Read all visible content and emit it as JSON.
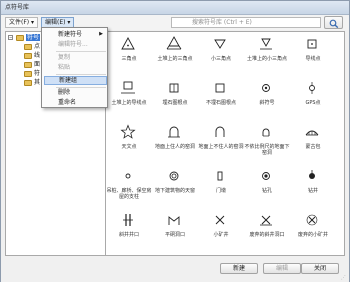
{
  "window": {
    "title": "点符号库"
  },
  "toolbar": {
    "file_menu": "文件(F) ▾",
    "edit_menu": "编辑(E) ▾",
    "search_placeholder": "搜索符号库 (Ctrl + E)"
  },
  "tree": {
    "root_label": "符号",
    "children": [
      "点",
      "线",
      "面",
      "符",
      "其"
    ]
  },
  "edit_menu_items": [
    {
      "label": "新建符号",
      "state": "normal",
      "has_submenu": true
    },
    {
      "label": "编辑符号...",
      "state": "disabled"
    },
    {
      "label": "复制",
      "state": "disabled"
    },
    {
      "label": "粘贴",
      "state": "disabled"
    },
    {
      "label": "新建组",
      "state": "hover"
    },
    {
      "label": "删除",
      "state": "normal"
    },
    {
      "label": "重命名",
      "state": "normal"
    }
  ],
  "symbols": [
    {
      "label": "三角点",
      "icon": "triangle-dot"
    },
    {
      "label": "土堆上的三角点",
      "icon": "mound-triangle-dot"
    },
    {
      "label": "小三角点",
      "icon": "small-triangle"
    },
    {
      "label": "土堆上的小三角点",
      "icon": "mound-small-triangle"
    },
    {
      "label": "导线点",
      "icon": "square-dot"
    },
    {
      "label": "土堆上的导线点",
      "icon": "mound-square"
    },
    {
      "label": "埋石图根点",
      "icon": "buried-stone"
    },
    {
      "label": "不埋石图根点",
      "icon": "unburied-stone"
    },
    {
      "label": "斜符号",
      "icon": "benchmark"
    },
    {
      "label": "GPS点",
      "icon": "gps-dot"
    },
    {
      "label": "天文点",
      "icon": "star"
    },
    {
      "label": "地面上住人的窑洞",
      "icon": "arch"
    },
    {
      "label": "地面上不住人的窑洞",
      "icon": "arch-open"
    },
    {
      "label": "不依比例尺的地面下窑洞",
      "icon": "arch-small"
    },
    {
      "label": "蒙古包",
      "icon": "yurt"
    },
    {
      "label": "吊桩、廊桥、保空房屋的支柱",
      "icon": "small-circle"
    },
    {
      "label": "地下建筑物的天窗",
      "icon": "double-circle"
    },
    {
      "label": "门墩",
      "icon": "door-pier"
    },
    {
      "label": "钻孔",
      "icon": "drill-hole"
    },
    {
      "label": "钻井",
      "icon": "drill-well"
    },
    {
      "label": "斜井井口",
      "icon": "incline-shaft"
    },
    {
      "label": "平硐洞口",
      "icon": "adit"
    },
    {
      "label": "小矿井",
      "icon": "small-mine"
    },
    {
      "label": "废弃的斜井洞口",
      "icon": "abandoned-shaft"
    },
    {
      "label": "废弃的小矿井",
      "icon": "abandoned-mine"
    }
  ],
  "footer": {
    "new_label": "新建",
    "edit_label": "编辑",
    "close_label": "关闭"
  }
}
